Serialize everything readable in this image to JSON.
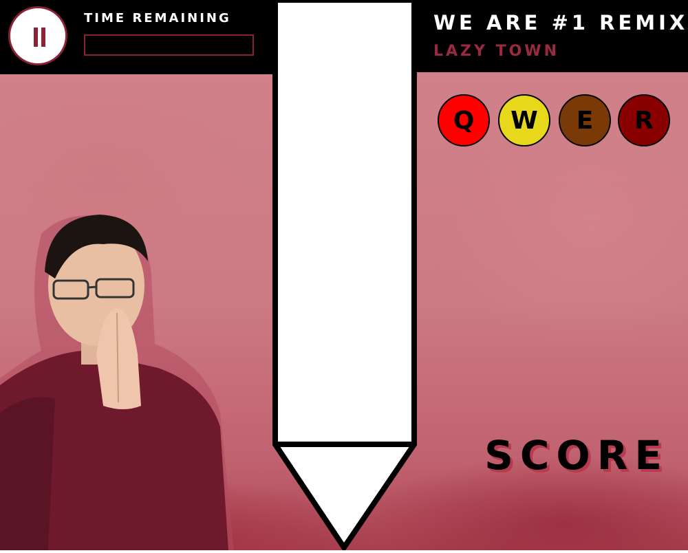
{
  "hud": {
    "pause_icon": "pause-icon",
    "time_label": "TIME REMAINING",
    "time_progress": 0
  },
  "song": {
    "title": "WE ARE #1 REMIX",
    "artist": "LAZY TOWN"
  },
  "keys": [
    {
      "label": "Q",
      "color": "#ff0000"
    },
    {
      "label": "W",
      "color": "#e8d81c"
    },
    {
      "label": "E",
      "color": "#7a3a08"
    },
    {
      "label": "R",
      "color": "#8a0000"
    }
  ],
  "score": {
    "label": "SCORE"
  },
  "colors": {
    "accent": "#8c2236",
    "background": "#d1838b",
    "hud": "#000000",
    "lane": "#ffffff"
  }
}
